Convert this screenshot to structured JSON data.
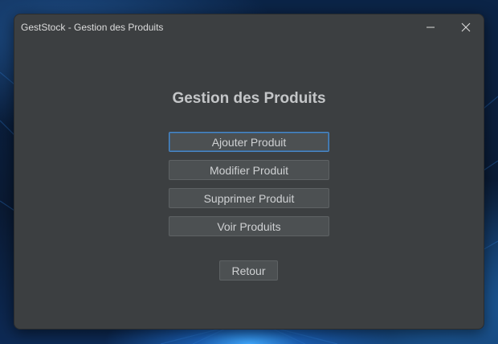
{
  "window": {
    "title": "GestStock - Gestion des Produits"
  },
  "main": {
    "heading": "Gestion des Produits",
    "buttons": {
      "add": "Ajouter Produit",
      "edit": "Modifier Produit",
      "delete": "Supprimer Produit",
      "view": "Voir Produits",
      "back": "Retour"
    }
  },
  "icons": {
    "minimize": "minimize-icon",
    "close": "close-icon"
  },
  "colors": {
    "window_bg": "#3c3f41",
    "button_bg": "#4c5052",
    "focus_border": "#4a88c7",
    "text": "#cfd1d3"
  }
}
